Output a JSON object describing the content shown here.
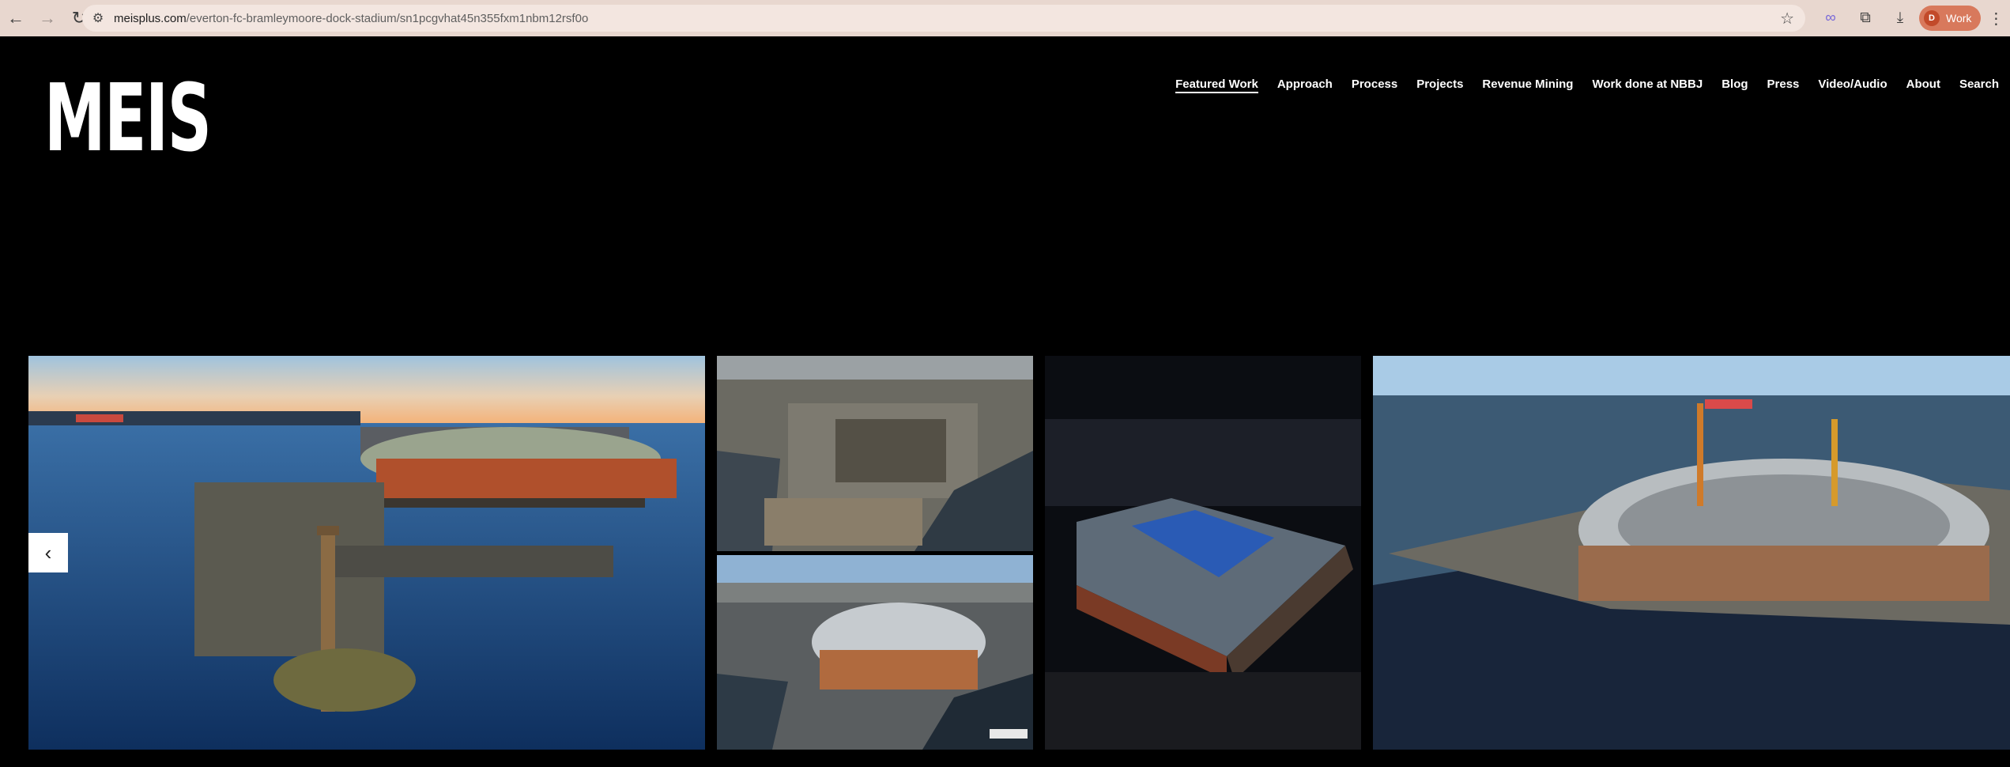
{
  "browser": {
    "url_domain": "meisplus.com",
    "url_path": "/everton-fc-bramleymoore-dock-stadium/sn1pcgvhat45n355fxm1nbm12rsf0o",
    "profile_initial": "D",
    "profile_label": "Work"
  },
  "site": {
    "logo": "MEIS",
    "nav": [
      {
        "label": "Featured Work",
        "active": true
      },
      {
        "label": "Approach"
      },
      {
        "label": "Process"
      },
      {
        "label": "Projects"
      },
      {
        "label": "Revenue Mining"
      },
      {
        "label": "Work done at NBBJ"
      },
      {
        "label": "Blog"
      },
      {
        "label": "Press"
      },
      {
        "label": "Video/Audio"
      },
      {
        "label": "About"
      },
      {
        "label": "Search"
      }
    ]
  },
  "gallery": {
    "prev_icon": "chevron-left-icon",
    "expand_icon": "plus-icon"
  },
  "colors": {
    "chrome_bg": "#e8d7cf",
    "profile_bg": "#d8795c",
    "page_bg": "#000000"
  }
}
